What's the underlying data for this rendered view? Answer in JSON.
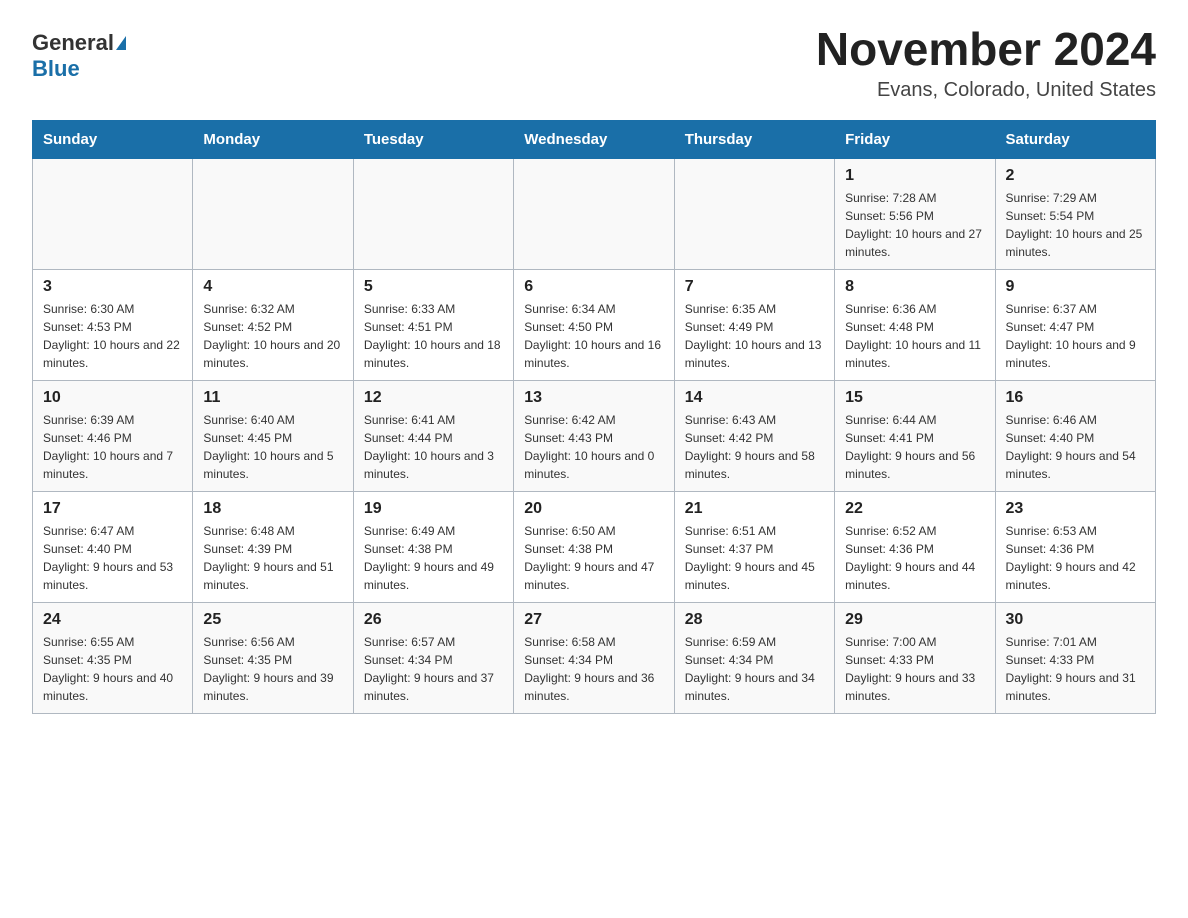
{
  "logo": {
    "general": "General",
    "blue": "Blue"
  },
  "header": {
    "month": "November 2024",
    "location": "Evans, Colorado, United States"
  },
  "weekdays": [
    "Sunday",
    "Monday",
    "Tuesday",
    "Wednesday",
    "Thursday",
    "Friday",
    "Saturday"
  ],
  "rows": [
    [
      {
        "day": "",
        "info": ""
      },
      {
        "day": "",
        "info": ""
      },
      {
        "day": "",
        "info": ""
      },
      {
        "day": "",
        "info": ""
      },
      {
        "day": "",
        "info": ""
      },
      {
        "day": "1",
        "info": "Sunrise: 7:28 AM\nSunset: 5:56 PM\nDaylight: 10 hours and 27 minutes."
      },
      {
        "day": "2",
        "info": "Sunrise: 7:29 AM\nSunset: 5:54 PM\nDaylight: 10 hours and 25 minutes."
      }
    ],
    [
      {
        "day": "3",
        "info": "Sunrise: 6:30 AM\nSunset: 4:53 PM\nDaylight: 10 hours and 22 minutes."
      },
      {
        "day": "4",
        "info": "Sunrise: 6:32 AM\nSunset: 4:52 PM\nDaylight: 10 hours and 20 minutes."
      },
      {
        "day": "5",
        "info": "Sunrise: 6:33 AM\nSunset: 4:51 PM\nDaylight: 10 hours and 18 minutes."
      },
      {
        "day": "6",
        "info": "Sunrise: 6:34 AM\nSunset: 4:50 PM\nDaylight: 10 hours and 16 minutes."
      },
      {
        "day": "7",
        "info": "Sunrise: 6:35 AM\nSunset: 4:49 PM\nDaylight: 10 hours and 13 minutes."
      },
      {
        "day": "8",
        "info": "Sunrise: 6:36 AM\nSunset: 4:48 PM\nDaylight: 10 hours and 11 minutes."
      },
      {
        "day": "9",
        "info": "Sunrise: 6:37 AM\nSunset: 4:47 PM\nDaylight: 10 hours and 9 minutes."
      }
    ],
    [
      {
        "day": "10",
        "info": "Sunrise: 6:39 AM\nSunset: 4:46 PM\nDaylight: 10 hours and 7 minutes."
      },
      {
        "day": "11",
        "info": "Sunrise: 6:40 AM\nSunset: 4:45 PM\nDaylight: 10 hours and 5 minutes."
      },
      {
        "day": "12",
        "info": "Sunrise: 6:41 AM\nSunset: 4:44 PM\nDaylight: 10 hours and 3 minutes."
      },
      {
        "day": "13",
        "info": "Sunrise: 6:42 AM\nSunset: 4:43 PM\nDaylight: 10 hours and 0 minutes."
      },
      {
        "day": "14",
        "info": "Sunrise: 6:43 AM\nSunset: 4:42 PM\nDaylight: 9 hours and 58 minutes."
      },
      {
        "day": "15",
        "info": "Sunrise: 6:44 AM\nSunset: 4:41 PM\nDaylight: 9 hours and 56 minutes."
      },
      {
        "day": "16",
        "info": "Sunrise: 6:46 AM\nSunset: 4:40 PM\nDaylight: 9 hours and 54 minutes."
      }
    ],
    [
      {
        "day": "17",
        "info": "Sunrise: 6:47 AM\nSunset: 4:40 PM\nDaylight: 9 hours and 53 minutes."
      },
      {
        "day": "18",
        "info": "Sunrise: 6:48 AM\nSunset: 4:39 PM\nDaylight: 9 hours and 51 minutes."
      },
      {
        "day": "19",
        "info": "Sunrise: 6:49 AM\nSunset: 4:38 PM\nDaylight: 9 hours and 49 minutes."
      },
      {
        "day": "20",
        "info": "Sunrise: 6:50 AM\nSunset: 4:38 PM\nDaylight: 9 hours and 47 minutes."
      },
      {
        "day": "21",
        "info": "Sunrise: 6:51 AM\nSunset: 4:37 PM\nDaylight: 9 hours and 45 minutes."
      },
      {
        "day": "22",
        "info": "Sunrise: 6:52 AM\nSunset: 4:36 PM\nDaylight: 9 hours and 44 minutes."
      },
      {
        "day": "23",
        "info": "Sunrise: 6:53 AM\nSunset: 4:36 PM\nDaylight: 9 hours and 42 minutes."
      }
    ],
    [
      {
        "day": "24",
        "info": "Sunrise: 6:55 AM\nSunset: 4:35 PM\nDaylight: 9 hours and 40 minutes."
      },
      {
        "day": "25",
        "info": "Sunrise: 6:56 AM\nSunset: 4:35 PM\nDaylight: 9 hours and 39 minutes."
      },
      {
        "day": "26",
        "info": "Sunrise: 6:57 AM\nSunset: 4:34 PM\nDaylight: 9 hours and 37 minutes."
      },
      {
        "day": "27",
        "info": "Sunrise: 6:58 AM\nSunset: 4:34 PM\nDaylight: 9 hours and 36 minutes."
      },
      {
        "day": "28",
        "info": "Sunrise: 6:59 AM\nSunset: 4:34 PM\nDaylight: 9 hours and 34 minutes."
      },
      {
        "day": "29",
        "info": "Sunrise: 7:00 AM\nSunset: 4:33 PM\nDaylight: 9 hours and 33 minutes."
      },
      {
        "day": "30",
        "info": "Sunrise: 7:01 AM\nSunset: 4:33 PM\nDaylight: 9 hours and 31 minutes."
      }
    ]
  ]
}
